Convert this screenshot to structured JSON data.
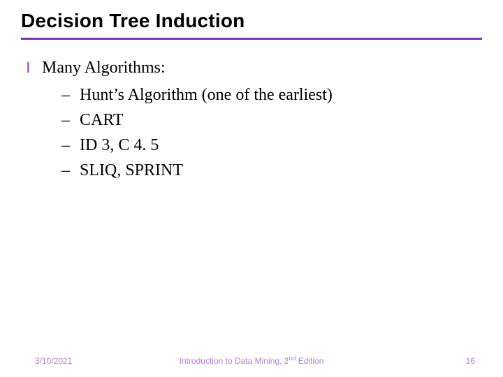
{
  "title": "Decision Tree Induction",
  "lead": "Many Algorithms:",
  "items": [
    "Hunt’s Algorithm (one of the earliest)",
    "CART",
    "ID 3, C 4. 5",
    "SLIQ, SPRINT"
  ],
  "footer": {
    "date": "3/10/2021",
    "center_prefix": "Introduction to Data Mining, 2",
    "center_sup": "nd",
    "center_suffix": " Edition",
    "page": "16"
  },
  "colors": {
    "accent": "#8a2abf"
  }
}
